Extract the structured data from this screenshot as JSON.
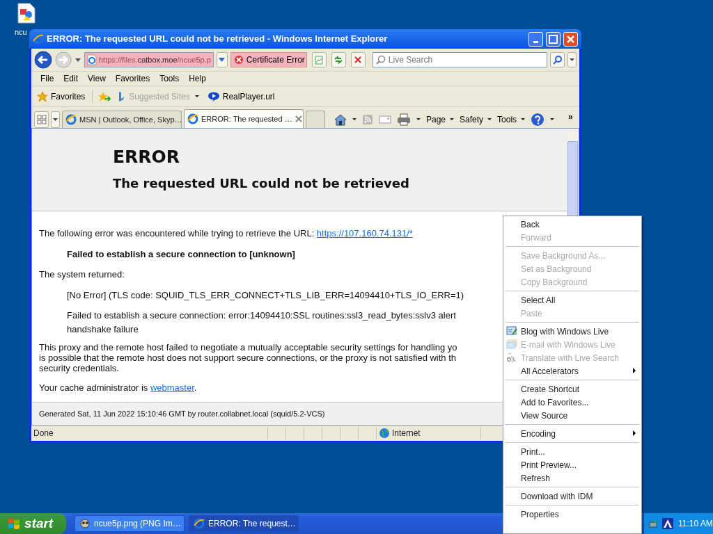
{
  "desktop_icons": [
    {
      "label": "ncu"
    }
  ],
  "window": {
    "title": "ERROR: The requested URL could not be retrieved - Windows Internet Explorer"
  },
  "address_bar": {
    "url_prefix": "https://files.",
    "url_domain": "catbox.moe",
    "url_suffix": "/ncue5p.p",
    "certificate": "Certificate Error"
  },
  "search": {
    "placeholder": "Live Search"
  },
  "menu_bar": [
    "File",
    "Edit",
    "View",
    "Favorites",
    "Tools",
    "Help"
  ],
  "favorites_bar": {
    "favorites": "Favorites",
    "links": [
      {
        "label": "Suggested Sites",
        "disabled": true,
        "dropdown": true,
        "kind": "sites"
      },
      {
        "label": "RealPlayer.url",
        "disabled": false,
        "dropdown": false,
        "kind": "player"
      }
    ]
  },
  "tabs": [
    {
      "label": "MSN | Outlook, Office, Skyp…",
      "selected": false
    },
    {
      "label": "ERROR: The requested …",
      "selected": true
    }
  ],
  "command_bar": {
    "items": [
      {
        "label": "Page"
      },
      {
        "label": "Safety"
      },
      {
        "label": "Tools"
      }
    ],
    "more": "»"
  },
  "page": {
    "heading": "ERROR",
    "subheading": "The requested URL could not be retrieved",
    "intro": "The following error was encountered while trying to retrieve the URL: ",
    "intro_link": "https://107.160.74.131/*",
    "failure": "Failed to establish a secure connection to [unknown]",
    "system_label": "The system returned:",
    "details": [
      "[No Error] (TLS code: SQUID_TLS_ERR_CONNECT+TLS_LIB_ERR=14094410+TLS_IO_ERR=1)",
      "Failed to establish a secure connection: error:14094410:SSL routines:ssl3_read_bytes:sslv3 alert handshake failure"
    ],
    "explanation_lines": [
      "This proxy and the remote host failed to negotiate a mutually acceptable security settings for handling yo",
      "is possible that the remote host does not support secure connections, or the proxy is not satisfied with th",
      "security credentials."
    ],
    "admin": "Your cache administrator is ",
    "admin_link": "webmaster",
    "admin_end": ".",
    "footer": "Generated Sat, 11 Jun 2022 15:10:46 GMT by router.collabnet.local (squid/5.2-VCS)"
  },
  "status_bar": {
    "text": "Done",
    "zone": "Internet"
  },
  "context_menu": {
    "groups": [
      [
        {
          "label": "Back",
          "disabled": false,
          "submenu": false,
          "kind": "plain"
        },
        {
          "label": "Forward",
          "disabled": true,
          "submenu": false,
          "kind": "plain"
        }
      ],
      [
        {
          "label": "Save Background As...",
          "disabled": true,
          "submenu": false,
          "kind": "plain"
        },
        {
          "label": "Set as Background",
          "disabled": true,
          "submenu": false,
          "kind": "plain"
        },
        {
          "label": "Copy Background",
          "disabled": true,
          "submenu": false,
          "kind": "plain"
        }
      ],
      [
        {
          "label": "Select All",
          "disabled": false,
          "submenu": false,
          "kind": "plain"
        },
        {
          "label": "Paste",
          "disabled": true,
          "submenu": false,
          "kind": "plain"
        }
      ],
      [
        {
          "label": "Blog with Windows Live",
          "disabled": false,
          "submenu": false,
          "kind": "blog"
        },
        {
          "label": "E-mail with Windows Live",
          "disabled": true,
          "submenu": false,
          "kind": "email"
        },
        {
          "label": "Translate with Live Search",
          "disabled": true,
          "submenu": false,
          "kind": "translate"
        },
        {
          "label": "All Accelerators",
          "disabled": false,
          "submenu": true,
          "kind": "plain"
        }
      ],
      [
        {
          "label": "Create Shortcut",
          "disabled": false,
          "submenu": false,
          "kind": "plain"
        },
        {
          "label": "Add to Favorites...",
          "disabled": false,
          "submenu": false,
          "kind": "plain"
        },
        {
          "label": "View Source",
          "disabled": false,
          "submenu": false,
          "kind": "plain"
        }
      ],
      [
        {
          "label": "Encoding",
          "disabled": false,
          "submenu": true,
          "kind": "plain"
        }
      ],
      [
        {
          "label": "Print...",
          "disabled": false,
          "submenu": false,
          "kind": "plain"
        },
        {
          "label": "Print Preview...",
          "disabled": false,
          "submenu": false,
          "kind": "plain"
        },
        {
          "label": "Refresh",
          "disabled": false,
          "submenu": false,
          "kind": "plain"
        }
      ],
      [
        {
          "label": "Download with IDM",
          "disabled": false,
          "submenu": false,
          "kind": "plain"
        }
      ],
      [
        {
          "label": "Properties",
          "disabled": false,
          "submenu": false,
          "kind": "plain"
        }
      ]
    ]
  },
  "taskbar": {
    "start": "start",
    "buttons": [
      {
        "label": "ncue5p.png (PNG Im…",
        "selected": false,
        "kind": "image"
      },
      {
        "label": "ERROR: The request…",
        "selected": true,
        "kind": "browser"
      }
    ],
    "clock": "11:10 AM"
  }
}
